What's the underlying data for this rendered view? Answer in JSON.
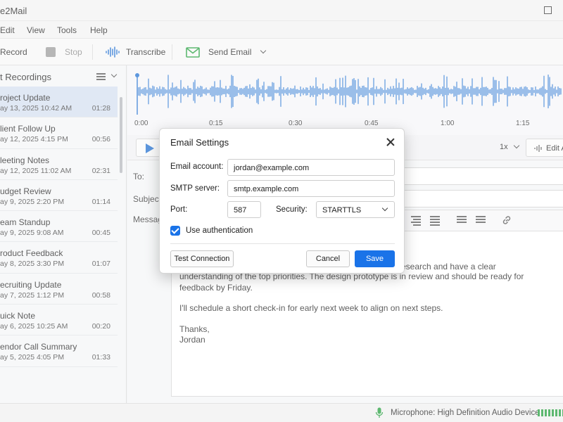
{
  "app": {
    "title": "e2Mail"
  },
  "menu": [
    "Edit",
    "View",
    "Tools",
    "Help"
  ],
  "toolbar": {
    "record": "Record",
    "stop": "Stop",
    "transcribe": "Transcribe",
    "send_email": "Send Email"
  },
  "sidebar": {
    "title": "t Recordings",
    "items": [
      {
        "name": "roject Update",
        "date": "ay 13, 2025 10:42 AM",
        "duration": "01:28",
        "selected": true
      },
      {
        "name": "lient Follow Up",
        "date": "ay 12, 2025 4:15 PM",
        "duration": "00:56"
      },
      {
        "name": "leeting Notes",
        "date": "ay 12, 2025 11:02 AM",
        "duration": "02:31"
      },
      {
        "name": "udget Review",
        "date": "ay 9, 2025 2:20 PM",
        "duration": "01:14"
      },
      {
        "name": "eam Standup",
        "date": "ay 9, 2025 9:08 AM",
        "duration": "00:45"
      },
      {
        "name": "roduct Feedback",
        "date": "ay 8, 2025 3:30 PM",
        "duration": "01:07"
      },
      {
        "name": "ecruiting Update",
        "date": "ay 7, 2025 1:12 PM",
        "duration": "00:58"
      },
      {
        "name": "uick Note",
        "date": "ay 6, 2025 10:25 AM",
        "duration": "00:20"
      },
      {
        "name": "endor Call Summary",
        "date": "ay 5, 2025 4:05 PM",
        "duration": "01:33"
      }
    ]
  },
  "timeline": [
    "0:00",
    "0:15",
    "0:30",
    "0:45",
    "1:00",
    "1:15"
  ],
  "playback": {
    "speed": "1x",
    "edit": "Edit A"
  },
  "compose": {
    "to_label": "To:",
    "subject_label": "Subject:",
    "message_label": "Message",
    "body": [
      "research and have a clear",
      "understanding of the top priorities. The design prototype is in review and should be ready for feedback by Friday.",
      "I'll schedule a short check-in for early next week to align on next steps.",
      "Thanks,",
      "Jordan"
    ]
  },
  "status": {
    "microphone": "Microphone: High Definition Audio Device"
  },
  "colors": {
    "accent": "#1a73e8",
    "waveform": "#1f6fd1",
    "selected_row": "#d5dff0",
    "level": "#1f9d3a"
  },
  "dialog": {
    "title": "Email Settings",
    "email_label": "Email account:",
    "email_value": "jordan@example.com",
    "smtp_label": "SMTP server:",
    "smtp_value": "smtp.example.com",
    "port_label": "Port:",
    "port_value": "587",
    "security_label": "Security:",
    "security_value": "STARTTLS",
    "auth_label": "Use authentication",
    "auth_checked": true,
    "test_button": "Test Connection",
    "cancel_button": "Cancel",
    "save_button": "Save"
  }
}
